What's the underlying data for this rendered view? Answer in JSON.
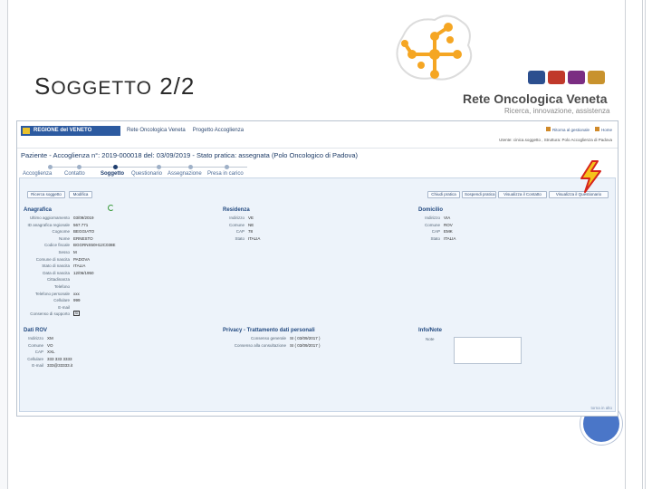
{
  "slide": {
    "title_cap": "S",
    "title_rest": "OGGETTO",
    "title_num": "2/2"
  },
  "brand": {
    "name": "Rete Oncologica Veneta",
    "tagline": "Ricerca, innovazione, assistenza",
    "colors": {
      "orange": "#f5a623",
      "dark": "#4d4d4d"
    }
  },
  "app": {
    "region_label": "REGIONE del VENETO",
    "nav": [
      "ROV",
      "Rete Oncologica Veneta",
      "Progetto Accoglienza"
    ],
    "top_links": [
      "Ritorna al gestionale",
      "Home"
    ],
    "user_line": "Utente: cinica.soggetto , Struttura: Polo Accoglienza di Padova",
    "practice_title": "Paziente - Accoglienza n°: 2019-000018 del: 03/09/2019 - Stato pratica: assegnata (Polo Oncologico di Padova)",
    "steps": [
      "Accoglienza",
      "Contatto",
      "Soggetto",
      "Questionario",
      "Assegnazione",
      "Presa in carico"
    ],
    "active_step_label": "Soggetto",
    "buttons_left": [
      "Ricerca soggetto",
      "Modifica"
    ],
    "buttons_right": [
      "Chiudi pratica",
      "Sospendi pratica",
      "Visualizza il Contatto",
      "Visualizza il Questionario"
    ],
    "anagrafica": {
      "title": "Anagrafica",
      "rows": [
        {
          "k": "Ultimo aggiornamento",
          "v": "03/09/2019"
        },
        {
          "k": "ID anagrafica regionale",
          "v": "567.771"
        },
        {
          "k": "Cognome",
          "v": "BEGGIATO"
        },
        {
          "k": "Nome",
          "v": "ERNESTO"
        },
        {
          "k": "Codice fiscale",
          "v": "BGGRNS50H12C038E"
        },
        {
          "k": "Sesso",
          "v": "M"
        },
        {
          "k": "Comune di nascita",
          "v": "PADOVA"
        },
        {
          "k": "Stato di nascita",
          "v": "ITALIA"
        },
        {
          "k": "Data di nascita",
          "v": "12/06/1950"
        },
        {
          "k": "Cittadinanza",
          "v": ""
        },
        {
          "k": "Telefono",
          "v": ""
        },
        {
          "k": "Telefono personale",
          "v": "xxx"
        },
        {
          "k": "Cellulare",
          "v": "999"
        },
        {
          "k": "E-mail",
          "v": ""
        },
        {
          "k": "Consenso di supporto",
          "v": "SI"
        }
      ]
    },
    "residenza": {
      "title": "Residenza",
      "rows": [
        {
          "k": "Indirizzo",
          "v": "VE"
        },
        {
          "k": "Comune",
          "v": "NE"
        },
        {
          "k": "CAP",
          "v": "78"
        },
        {
          "k": "Stato",
          "v": "ITALIA"
        }
      ]
    },
    "domicilio": {
      "title": "Domicilio",
      "rows": [
        {
          "k": "Indirizzo",
          "v": "VIA"
        },
        {
          "k": "Comune",
          "v": "ROV"
        },
        {
          "k": "CAP",
          "v": "EMK"
        },
        {
          "k": "Stato",
          "v": "ITALIA"
        }
      ]
    },
    "dati_rov": {
      "title": "Dati ROV",
      "rows": [
        {
          "k": "Indirizzo",
          "v": "XM"
        },
        {
          "k": "Comune",
          "v": "VO"
        },
        {
          "k": "CAP",
          "v": "XXL"
        },
        {
          "k": "Cellulare",
          "v": "333 333 3333"
        },
        {
          "k": "E-mail",
          "v": "333@33333.it"
        }
      ]
    },
    "privacy": {
      "title": "Privacy - Trattamento dati personali",
      "rows": [
        {
          "k": "Consenso generale",
          "v": "SI  ( 03/09/2017 )"
        },
        {
          "k": "Consenso alla consultazione",
          "v": "SI  ( 03/09/2017 )"
        }
      ]
    },
    "info": {
      "title": "Info/Note",
      "note_label": "Note"
    },
    "footer_link": "torna in alto"
  }
}
